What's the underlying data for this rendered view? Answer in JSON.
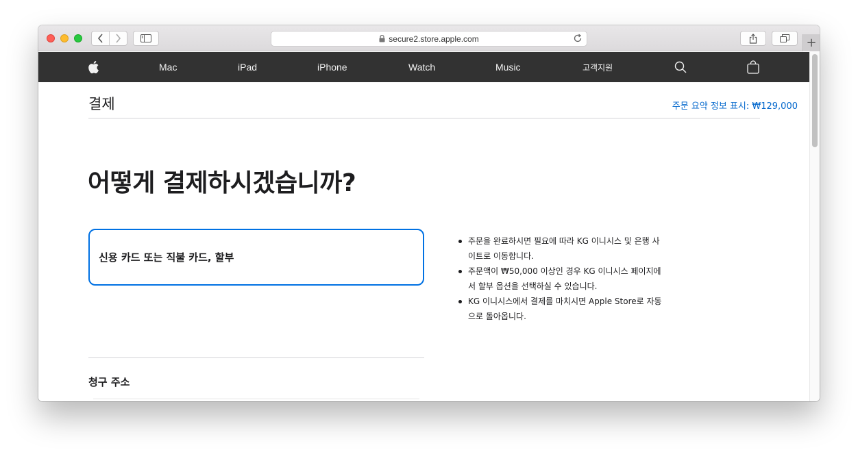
{
  "browser": {
    "url": "secure2.store.apple.com"
  },
  "nav": {
    "items": [
      {
        "label": "Mac"
      },
      {
        "label": "iPad"
      },
      {
        "label": "iPhone"
      },
      {
        "label": "Watch"
      },
      {
        "label": "Music"
      },
      {
        "label": "고객지원"
      }
    ],
    "icons": [
      "apple-logo-icon",
      "search-icon",
      "shopping-bag-icon"
    ]
  },
  "checkout": {
    "title": "결제",
    "summary_link": "주문 요약 정보 표시: ₩129,000",
    "headline": "어떻게 결제하시겠습니까?",
    "payment_option": "신용 카드 또는 직불 카드, 할부",
    "info": [
      "주문을 완료하시면 필요에 따라 KG 이니시스 및 은행 사이트로 이동합니다.",
      "주문액이 ₩50,000 이상인 경우 KG 이니시스 페이지에서 할부 옵션을 선택하실 수 있습니다.",
      "KG 이니시스에서 결제를 마치시면 Apple Store로 자동으로 돌아옵니다."
    ],
    "billing_title": "청구 주소"
  },
  "colors": {
    "nav_bg": "#323232",
    "link": "#0066cc",
    "accent_border": "#0071e3"
  }
}
